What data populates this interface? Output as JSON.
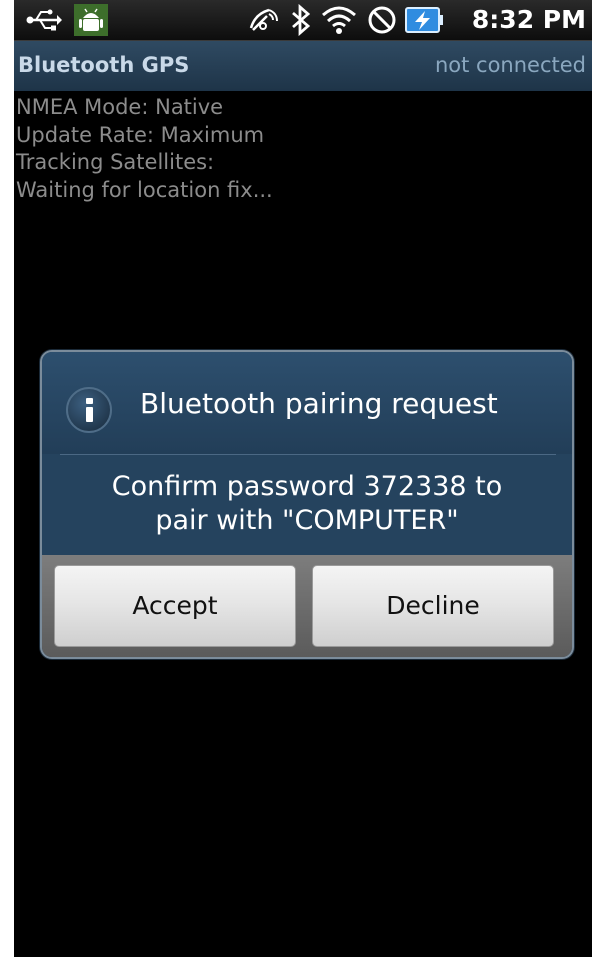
{
  "status_bar": {
    "time": "8:32 PM",
    "icons": [
      "usb-icon",
      "android-debug-icon",
      "gps-icon",
      "bluetooth-icon",
      "wifi-icon",
      "do-not-disturb-icon",
      "battery-charging-icon"
    ]
  },
  "app_bar": {
    "title": "Bluetooth GPS",
    "status": "not connected"
  },
  "info_lines": [
    "NMEA Mode: Native",
    "Update Rate: Maximum",
    "Tracking Satellites:",
    "Waiting for location fix..."
  ],
  "dialog": {
    "icon": "info-icon",
    "title": "Bluetooth pairing request",
    "message_line1": "Confirm password 372338 to",
    "message_line2": "pair with \"COMPUTER\"",
    "accept_label": "Accept",
    "decline_label": "Decline"
  },
  "colors": {
    "app_bar_bg": "#1e3448",
    "dialog_bg": "#25435e",
    "info_text": "#8c8c8c"
  }
}
